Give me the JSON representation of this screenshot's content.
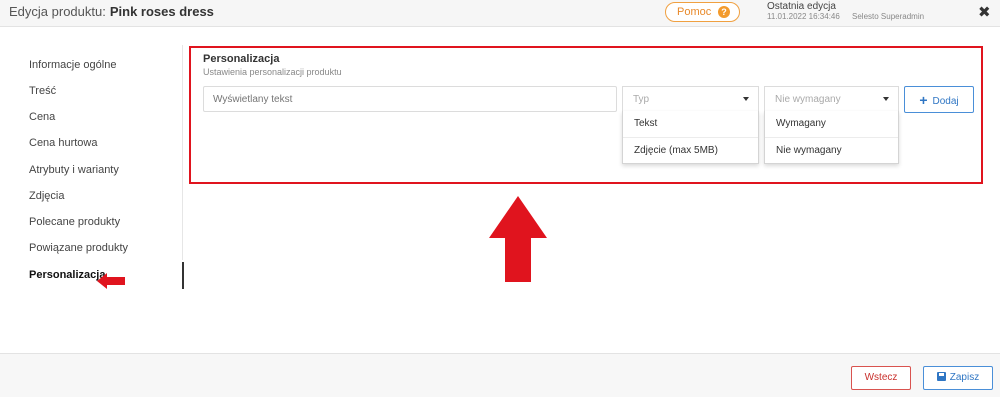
{
  "header": {
    "label": "Edycja produktu:",
    "product_name": "Pink roses dress",
    "help_label": "Pomoc",
    "help_icon_glyph": "?",
    "last_edit_label": "Ostatnia edycja",
    "last_edit_date": "11.01.2022  16:34:46",
    "last_edit_user": "Selesto Superadmin",
    "close_glyph": "✖"
  },
  "sidebar": {
    "items": [
      {
        "label": "Informacje ogólne"
      },
      {
        "label": "Treść"
      },
      {
        "label": "Cena"
      },
      {
        "label": "Cena hurtowa"
      },
      {
        "label": "Atrybuty i warianty"
      },
      {
        "label": "Zdjęcia"
      },
      {
        "label": "Polecane produkty"
      },
      {
        "label": "Powiązane produkty"
      },
      {
        "label": "Personalizacja"
      }
    ],
    "active_item": "Personalizacja"
  },
  "panel": {
    "title": "Personalizacja",
    "subtitle": "Ustawienia personalizacji produktu",
    "text_input_placeholder": "Wyświetlany tekst",
    "type_select": {
      "placeholder": "Typ",
      "options": [
        "Tekst",
        "Zdjęcie (max 5MB)"
      ]
    },
    "required_select": {
      "placeholder": "Nie wymagany",
      "options": [
        "Wymagany",
        "Nie wymagany"
      ]
    },
    "add_label": "Dodaj"
  },
  "footer": {
    "back_label": "Wstecz",
    "save_label": "Zapisz"
  },
  "colors": {
    "annotation_red": "#e0141e",
    "accent_blue": "#2f76c4",
    "help_orange": "#f39a2c"
  }
}
